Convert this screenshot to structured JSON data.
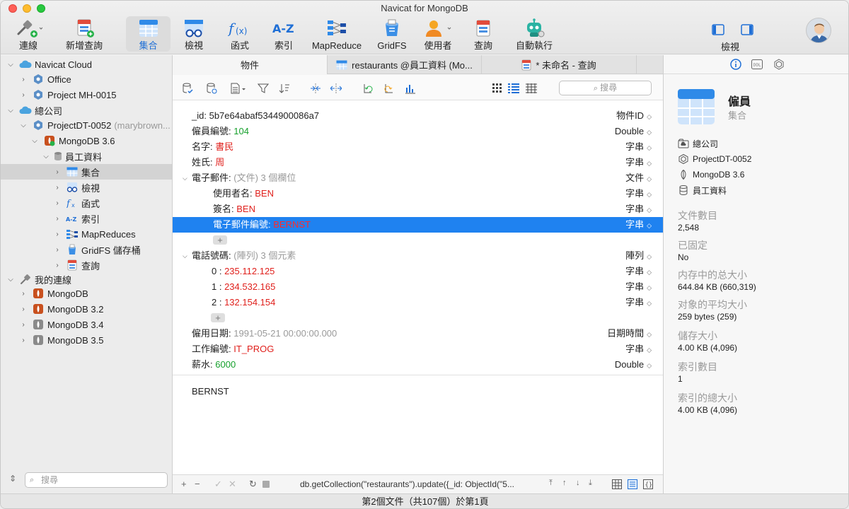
{
  "window": {
    "title": "Navicat for MongoDB"
  },
  "toolbar": {
    "items": [
      {
        "label": "連線",
        "icon": "connection-icon"
      },
      {
        "label": "新增查詢",
        "icon": "new-query-icon"
      },
      {
        "label": "集合",
        "icon": "collection-icon"
      },
      {
        "label": "檢視",
        "icon": "view-icon"
      },
      {
        "label": "函式",
        "icon": "function-icon"
      },
      {
        "label": "索引",
        "icon": "index-icon"
      },
      {
        "label": "MapReduce",
        "icon": "mapreduce-icon"
      },
      {
        "label": "GridFS",
        "icon": "gridfs-icon"
      },
      {
        "label": "使用者",
        "icon": "user-icon"
      },
      {
        "label": "查詢",
        "icon": "query-icon"
      },
      {
        "label": "自動執行",
        "icon": "automation-icon"
      }
    ],
    "view_label": "檢視"
  },
  "sidebar": {
    "tree": [
      {
        "label": "Navicat Cloud",
        "icon": "cloud-icon"
      },
      {
        "label": "Office",
        "icon": "project-icon"
      },
      {
        "label": "Project MH-0015",
        "icon": "project-icon"
      },
      {
        "label": "總公司",
        "icon": "cloud-icon"
      },
      {
        "label": "ProjectDT-0052",
        "extra": "(marybrown...",
        "icon": "project-icon"
      },
      {
        "label": "MongoDB 3.6",
        "icon": "mongodb-connection-icon"
      },
      {
        "label": "員工資料",
        "icon": "database-icon"
      },
      {
        "label": "集合",
        "icon": "collection-icon"
      },
      {
        "label": "檢視",
        "icon": "view-icon"
      },
      {
        "label": "函式",
        "icon": "function-icon"
      },
      {
        "label": "索引",
        "icon": "index-icon"
      },
      {
        "label": "MapReduces",
        "icon": "mapreduce-icon"
      },
      {
        "label": "GridFS 儲存桶",
        "icon": "gridfs-icon"
      },
      {
        "label": "查詢",
        "icon": "query-icon"
      },
      {
        "label": "我的連線",
        "icon": "connection-icon"
      },
      {
        "label": "MongoDB",
        "icon": "mongodb-icon"
      },
      {
        "label": "MongoDB 3.2",
        "icon": "mongodb-icon"
      },
      {
        "label": "MongoDB 3.4",
        "icon": "mongodb-icon"
      },
      {
        "label": "MongoDB 3.5",
        "icon": "mongodb-icon"
      }
    ],
    "search_placeholder": "搜尋"
  },
  "tabs": [
    {
      "label": "物件"
    },
    {
      "label": "restaurants @員工資料 (Mo..."
    },
    {
      "label": "* 未命名 - 查詢"
    }
  ],
  "doc_toolbar": {
    "search_placeholder": "搜尋"
  },
  "document": {
    "fields": [
      {
        "key": "_id",
        "value": "5b7e64abaf5344900086a7",
        "type": "物件ID"
      },
      {
        "key": "僱員編號",
        "value": "104",
        "type": "Double"
      },
      {
        "key": "名字",
        "value": "書民",
        "type": "字串"
      },
      {
        "key": "姓氏",
        "value": "周",
        "type": "字串"
      },
      {
        "key": "電子郵件",
        "value": "(文件) 3 個欄位",
        "type": "文件"
      },
      {
        "key": "使用者名",
        "value": "BEN",
        "type": "字串"
      },
      {
        "key": "簽名",
        "value": "BEN",
        "type": "字串"
      },
      {
        "key": "電子郵件編號",
        "value": "BERNST",
        "type": "字串"
      },
      {
        "key": "電話號碼",
        "value": "(陣列) 3 個元素",
        "type": "陣列"
      },
      {
        "key": "0",
        "value": "235.112.125",
        "type": "字串"
      },
      {
        "key": "1",
        "value": "234.532.165",
        "type": "字串"
      },
      {
        "key": "2",
        "value": "132.154.154",
        "type": "字串"
      },
      {
        "key": "僱用日期",
        "value": "1991-05-21 00:00:00.000",
        "type": "日期時間"
      },
      {
        "key": "工作編號",
        "value": "IT_PROG",
        "type": "字串"
      },
      {
        "key": "薪水",
        "value": "6000",
        "type": "Double"
      }
    ],
    "selected_value": "BERNST"
  },
  "bottom": {
    "query": "db.getCollection(\"restaurants\").update({_id: ObjectId(\"5..."
  },
  "info": {
    "name": "僱員",
    "kind": "集合",
    "path": [
      "總公司",
      "ProjectDT-0052",
      "MongoDB 3.6",
      "員工資料"
    ],
    "stats": [
      {
        "label": "文件數目",
        "value": "2,548"
      },
      {
        "label": "已固定",
        "value": "No"
      },
      {
        "label": "内存中的总大小",
        "value": "644.84 KB (660,319)"
      },
      {
        "label": "对象的平均大小",
        "value": "259 bytes (259)"
      },
      {
        "label": "儲存大小",
        "value": "4.00 KB (4,096)"
      },
      {
        "label": "索引數目",
        "value": "1"
      },
      {
        "label": "索引的總大小",
        "value": "4.00 KB (4,096)"
      }
    ]
  },
  "status": {
    "text": "第2個文件（共107個）於第1頁"
  },
  "colors": {
    "accent": "#1f82f0",
    "string_value": "#e0201c",
    "number_value": "#16a02c"
  }
}
